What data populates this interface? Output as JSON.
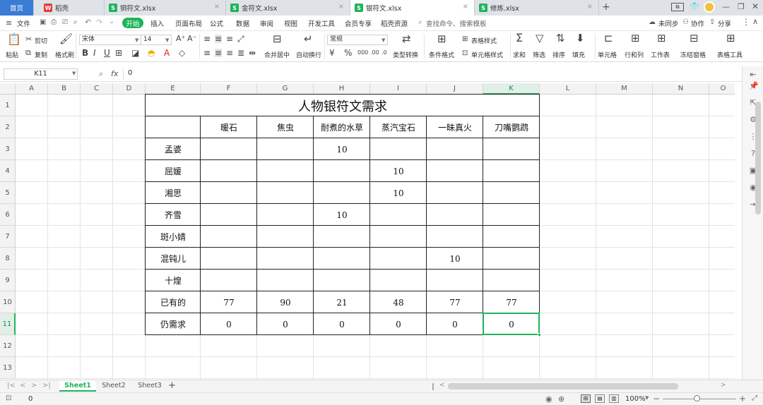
{
  "tabs": {
    "home": "首页",
    "items": [
      {
        "label": "稻壳",
        "badge": "W",
        "color": "#e8393b"
      },
      {
        "label": "铜符文.xlsx",
        "badge": "S",
        "color": "#1eb45a"
      },
      {
        "label": "金符文.xlsx",
        "badge": "S",
        "color": "#1eb45a"
      },
      {
        "label": "银符文.xlsx",
        "badge": "S",
        "color": "#1eb45a"
      },
      {
        "label": "修炼.xlsx",
        "badge": "S",
        "color": "#1eb45a"
      }
    ],
    "new_tab": "+"
  },
  "menu": {
    "file": "文件",
    "start": "开始",
    "items": [
      "插入",
      "页面布局",
      "公式",
      "数据",
      "审阅",
      "视图",
      "开发工具",
      "会员专享",
      "稻壳资源"
    ],
    "search_placeholder": "查找命令、搜索模板",
    "sync": "未同步",
    "collab": "协作",
    "share": "分享"
  },
  "ribbon": {
    "cut": "剪切",
    "copy": "复制",
    "paste": "粘贴",
    "format_painter": "格式刷",
    "font_name": "宋体",
    "font_size": "14",
    "merge_center": "合并居中",
    "wrap_text": "自动换行",
    "number_format": "常规",
    "type_convert": "类型转换",
    "cond_format": "条件格式",
    "table_style": "表格样式",
    "cell_style": "单元格样式",
    "sum": "求和",
    "filter": "筛选",
    "sort": "排序",
    "fill": "填充",
    "cell": "单元格",
    "row_col": "行和列",
    "worksheet": "工作表",
    "freeze": "冻结窗格",
    "table_tools": "表格工具"
  },
  "formula_bar": {
    "cell_ref": "K11",
    "fx": "fx",
    "value": "0"
  },
  "grid": {
    "columns": [
      "A",
      "B",
      "C",
      "D",
      "E",
      "F",
      "G",
      "H",
      "I",
      "J",
      "K",
      "L",
      "M",
      "N",
      "O"
    ],
    "rows": [
      "1",
      "2",
      "3",
      "4",
      "5",
      "6",
      "7",
      "8",
      "9",
      "10",
      "11",
      "12",
      "13"
    ],
    "selected_col": "K",
    "selected_row": "11"
  },
  "table": {
    "title": "人物银符文需求",
    "headers": [
      "暖石",
      "焦虫",
      "耐煮的水草",
      "蒸汽宝石",
      "一昧真火",
      "刀嘴鹦鹉"
    ],
    "rows": [
      {
        "name": "孟婆",
        "values": [
          "",
          "",
          "10",
          "",
          "",
          ""
        ]
      },
      {
        "name": "屈媛",
        "values": [
          "",
          "",
          "",
          "10",
          "",
          ""
        ]
      },
      {
        "name": "湘思",
        "values": [
          "",
          "",
          "",
          "10",
          "",
          ""
        ]
      },
      {
        "name": "齐雪",
        "values": [
          "",
          "",
          "10",
          "",
          "",
          ""
        ]
      },
      {
        "name": "斑小婧",
        "values": [
          "",
          "",
          "",
          "",
          "",
          ""
        ]
      },
      {
        "name": "混钝儿",
        "values": [
          "",
          "",
          "",
          "",
          "10",
          ""
        ]
      },
      {
        "name": "十煌",
        "values": [
          "",
          "",
          "",
          "",
          "",
          ""
        ]
      },
      {
        "name": "已有的",
        "values": [
          "77",
          "90",
          "21",
          "48",
          "77",
          "77"
        ]
      },
      {
        "name": "仍需求",
        "values": [
          "0",
          "0",
          "0",
          "0",
          "0",
          "0"
        ]
      }
    ]
  },
  "sheets": {
    "items": [
      "Sheet1",
      "Sheet2",
      "Sheet3"
    ],
    "active": "Sheet1",
    "add": "+"
  },
  "status": {
    "value": "0",
    "zoom": "100%"
  }
}
